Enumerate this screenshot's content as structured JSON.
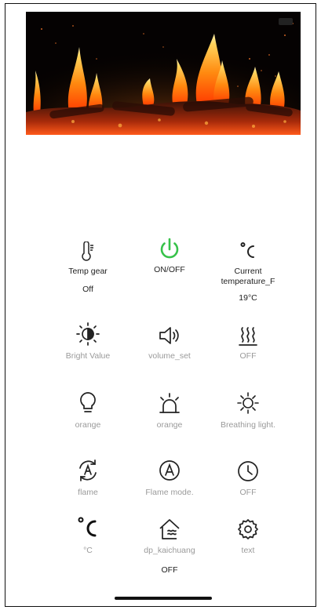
{
  "colors": {
    "power_green": "#37c24a",
    "muted_text": "#9a9a9a",
    "dark_text": "#222222"
  },
  "hero": {
    "icon": "fireplace-flames-image"
  },
  "controls": [
    {
      "name": "temp-gear",
      "icon": "thermometer-icon",
      "label": "Temp gear",
      "value": "Off"
    },
    {
      "name": "power",
      "icon": "power-icon",
      "label": "ON/OFF",
      "value": ""
    },
    {
      "name": "current-temperature",
      "icon": "celsius-icon",
      "label": "Current temperature_F",
      "value": "19°C"
    },
    {
      "name": "bright-value",
      "icon": "brightness-icon",
      "label": "Bright Value",
      "value": ""
    },
    {
      "name": "volume-set",
      "icon": "speaker-icon",
      "label": "volume_set",
      "value": ""
    },
    {
      "name": "heat",
      "icon": "heat-waves-icon",
      "label": "OFF",
      "value": ""
    },
    {
      "name": "bulb-color",
      "icon": "lightbulb-icon",
      "label": "orange",
      "value": ""
    },
    {
      "name": "alarm-color",
      "icon": "siren-icon",
      "label": "orange",
      "value": ""
    },
    {
      "name": "breathing-light",
      "icon": "sun-icon",
      "label": "Breathing light.",
      "value": ""
    },
    {
      "name": "flame",
      "icon": "auto-rotate-icon",
      "label": "flame",
      "value": ""
    },
    {
      "name": "flame-mode",
      "icon": "auto-mode-icon",
      "label": "Flame mode.",
      "value": ""
    },
    {
      "name": "timer",
      "icon": "clock-icon",
      "label": "OFF",
      "value": ""
    },
    {
      "name": "celsius-unit",
      "icon": "celsius-large-icon",
      "label": "°C",
      "value": ""
    },
    {
      "name": "dp-kaichuang",
      "icon": "house-window-icon",
      "label": "dp_kaichuang",
      "value": "OFF"
    },
    {
      "name": "text",
      "icon": "gear-icon",
      "label": "text",
      "value": ""
    }
  ]
}
